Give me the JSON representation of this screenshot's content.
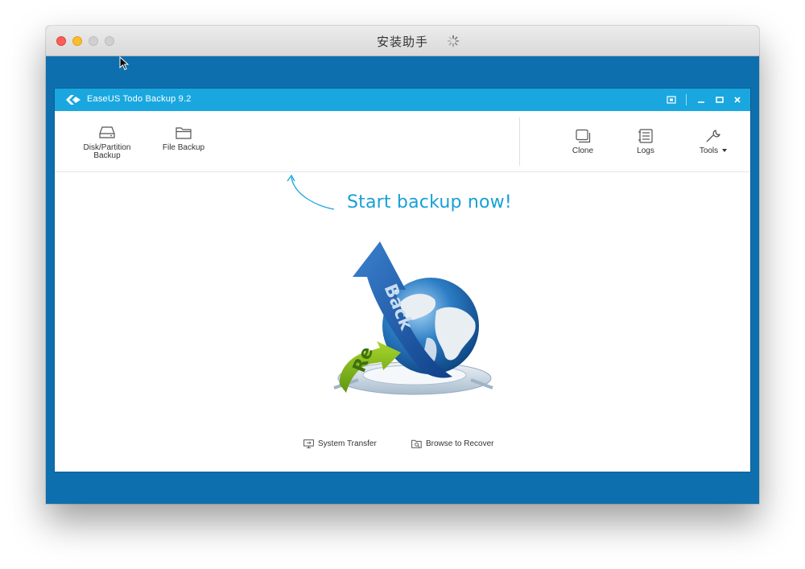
{
  "mac_window": {
    "title": "安装助手"
  },
  "app": {
    "title": "EaseUS Todo Backup 9.2",
    "accent_color": "#1aa7df",
    "toolbar_left": [
      {
        "label_line1": "Disk/Partition",
        "label_line2": "Backup",
        "icon": "hard-drive-icon"
      },
      {
        "label": "File Backup",
        "icon": "folder-icon"
      }
    ],
    "toolbar_right": [
      {
        "label": "Clone",
        "icon": "clone-icon"
      },
      {
        "label": "Logs",
        "icon": "logs-icon"
      },
      {
        "label": "Tools",
        "icon": "wrench-icon"
      }
    ],
    "hero": {
      "headline": "Start backup now!",
      "arrow_text_blue": "Back",
      "arrow_text_green": "Re"
    },
    "bottom_links": [
      {
        "label": "System Transfer",
        "icon": "system-transfer-icon"
      },
      {
        "label": "Browse to Recover",
        "icon": "browse-recover-icon"
      }
    ]
  },
  "colors": {
    "desktop_blue": "#0d6fae",
    "headline": "#18a0d6"
  }
}
